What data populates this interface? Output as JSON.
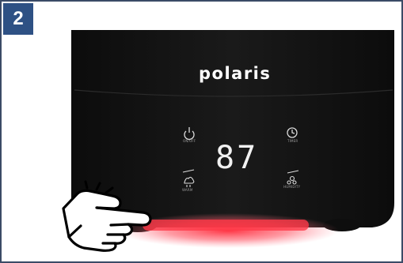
{
  "step": {
    "number": "2"
  },
  "device": {
    "brand": "polaris",
    "display_value": "87",
    "buttons": {
      "power": "ON/OFF",
      "timer": "TIMER",
      "warm": "WARM",
      "humidity": "HUMIDITY"
    }
  },
  "colors": {
    "step_badge": "#2e5184",
    "frame_border": "#3b4b66",
    "device_body": "#141414",
    "night_light": "#ff2a3a"
  }
}
